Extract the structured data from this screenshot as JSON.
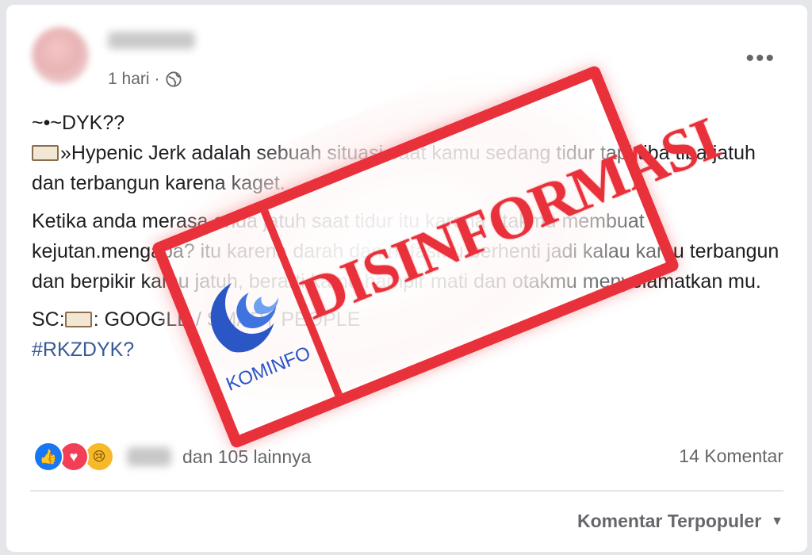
{
  "post": {
    "meta_time": "1 hari",
    "meta_dot": "·",
    "more_label": "•••",
    "paragraphs": {
      "line_dyk": "~•~DYK??",
      "intro": "»Hypenic Jerk adalah sebuah situasi saat kamu sedang tidur tapi tiba tiba jatuh dan terbangun karena kaget.",
      "body": "Ketika anda merasa anda jatuh saat tidur itu karena otakmu membuat kejutan.mengapa? itu karena darah dan nafasmu berhenti jadi kalau kamu terbangun dan berpikir kamu jatuh, berarti kamu hampir mati dan otakmu menyelamatkan mu.",
      "source": ": GOOGLE / SMART PEOPLE",
      "source_prefix": "SC:",
      "hashtag": "#RKZDYK?"
    }
  },
  "engagement": {
    "reaction_count_text": "dan 105 lainnya",
    "comments_text": "14 Komentar",
    "sort_label": "Komentar Terpopuler",
    "reactions": [
      "like",
      "love",
      "sad"
    ]
  },
  "stamp": {
    "word": "DISINFORMASI",
    "logo_text": "KOMINFO",
    "color": "#e8313a",
    "logo_color": "#2a56c6"
  },
  "icons": {
    "globe": "globe-icon",
    "book": "book-emoji-icon",
    "more": "more-options-icon",
    "caret": "caret-down-icon"
  },
  "colors": {
    "text_primary": "#1c1e21",
    "text_secondary": "#65676b",
    "hashtag": "#385898",
    "like": "#1877f2",
    "love": "#f33e58",
    "sad": "#f7b928"
  }
}
